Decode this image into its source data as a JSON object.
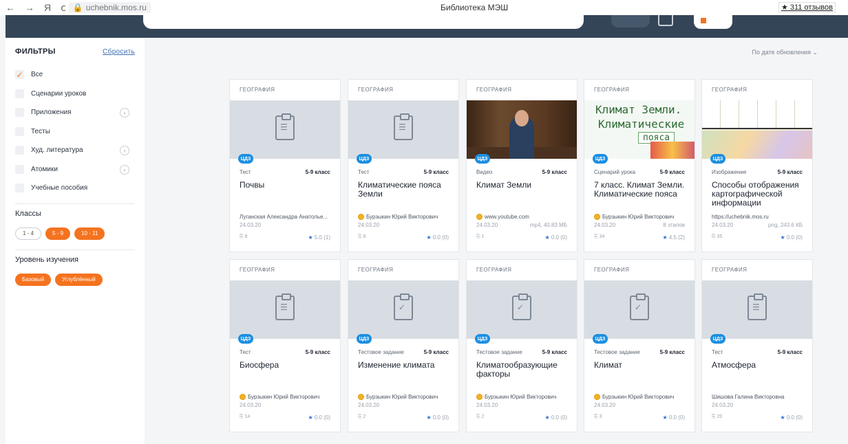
{
  "browser": {
    "back": "←",
    "forward": "→",
    "ya": "Я",
    "reload": "ⅽ",
    "url": "uchebnik.mos.ru",
    "title": "Библиотека МЭШ",
    "reviews": "★ 311 отзывов"
  },
  "sidebar": {
    "filters_title": "ФИЛЬТРЫ",
    "reset_label": "Сбросить",
    "filters": [
      {
        "label": "Все",
        "checked": true,
        "has_sub": false
      },
      {
        "label": "Сценарии уроков",
        "checked": false,
        "has_sub": false
      },
      {
        "label": "Приложения",
        "checked": false,
        "has_sub": true
      },
      {
        "label": "Тесты",
        "checked": false,
        "has_sub": false
      },
      {
        "label": "Худ. литература",
        "checked": false,
        "has_sub": true
      },
      {
        "label": "Атомики",
        "checked": false,
        "has_sub": true
      },
      {
        "label": "Учебные пособия",
        "checked": false,
        "has_sub": false
      }
    ],
    "classes_title": "Классы",
    "classes": [
      "1 - 4",
      "5 - 9",
      "10 - 11"
    ],
    "level_title": "Уровень изучения",
    "levels": [
      "Базовый",
      "Углублённый"
    ]
  },
  "sort_label": "По дате обновления ⌄",
  "badge_label": "ЦДЗ",
  "cards": [
    {
      "subject": "ГЕОГРАФИЯ",
      "type": "Тест",
      "grade": "5-9 класс",
      "name": "Почвы",
      "author": "Луганская Александра Анатолье...",
      "medal": false,
      "date": "24.03.20",
      "extra": "",
      "clips": "8",
      "rating": "5.0 (1)"
    },
    {
      "subject": "ГЕОГРАФИЯ",
      "type": "Тест",
      "grade": "5-9 класс",
      "name": "Климатические пояса Земли",
      "author": "Бурзыкин Юрий Викторович",
      "medal": true,
      "date": "24.03.20",
      "extra": "",
      "clips": "8",
      "rating": "0.0 (0)"
    },
    {
      "subject": "ГЕОГРАФИЯ",
      "type": "Видео",
      "grade": "5-9 класс",
      "name": "Климат Земли",
      "author": "www.youtube.com",
      "medal": true,
      "date": "24.03.20",
      "extra": "mp4, 40.83 МБ",
      "clips": "1",
      "rating": "0.0 (0)"
    },
    {
      "subject": "ГЕОГРАФИЯ",
      "type": "Сценарий урока",
      "grade": "5-9 класс",
      "name": "7 класс. Климат Земли. Климатические пояса",
      "author": "Бурзыкин Юрий Викторович",
      "medal": true,
      "date": "24.03.20",
      "extra": "8 этапов",
      "clips": "34",
      "rating": "4.5 (2)"
    },
    {
      "subject": "ГЕОГРАФИЯ",
      "type": "Изображение",
      "grade": "5-9 класс",
      "name": "Способы отображения картографической информации",
      "author": "https://uchebnik.mos.ru",
      "medal": false,
      "date": "24.03.20",
      "extra": "png, 243.6 КБ",
      "clips": "35",
      "rating": "0.0 (0)"
    },
    {
      "subject": "ГЕОГРАФИЯ",
      "type": "Тест",
      "grade": "5-9 класс",
      "name": "Биосфера",
      "author": "Бурзыкин Юрий Викторович",
      "medal": true,
      "date": "24.03.20",
      "extra": "",
      "clips": "14",
      "rating": "0.0 (0)"
    },
    {
      "subject": "ГЕОГРАФИЯ",
      "type": "Тестовое задание",
      "grade": "5-9 класс",
      "name": "Изменение климата",
      "author": "Бурзыкин Юрий Викторович",
      "medal": true,
      "date": "24.03.20",
      "extra": "",
      "clips": "2",
      "rating": "0.0 (0)"
    },
    {
      "subject": "ГЕОГРАФИЯ",
      "type": "Тестовое задание",
      "grade": "5-9 класс",
      "name": "Климатообразующие факторы",
      "author": "Бурзыкин Юрий Викторович",
      "medal": true,
      "date": "24.03.20",
      "extra": "",
      "clips": "2",
      "rating": "0.0 (0)"
    },
    {
      "subject": "ГЕОГРАФИЯ",
      "type": "Тестовое задание",
      "grade": "5-9 класс",
      "name": "Климат",
      "author": "Бурзыкин Юрий Викторович",
      "medal": true,
      "date": "24.03.20",
      "extra": "",
      "clips": "3",
      "rating": "0.0 (0)"
    },
    {
      "subject": "ГЕОГРАФИЯ",
      "type": "Тест",
      "grade": "5-9 класс",
      "name": "Атмосфера",
      "author": "Шишова Галина Викторовна",
      "medal": false,
      "date": "24.03.20",
      "extra": "",
      "clips": "20",
      "rating": "0.0 (0)"
    }
  ],
  "thumb_texts": {
    "climate_line1": "Климат Земли.",
    "climate_line2": "Климатические",
    "climate_line3": "пояса"
  },
  "icons": {
    "test": "clipboard-list-icon",
    "task": "clipboard-check-icon",
    "paperclip": "paperclip-icon",
    "star": "star-icon",
    "medal": "medal-icon"
  },
  "colors": {
    "accent": "#f5731f",
    "header": "#344558",
    "badge": "#1d8fe1",
    "link": "#3f6fb0"
  }
}
